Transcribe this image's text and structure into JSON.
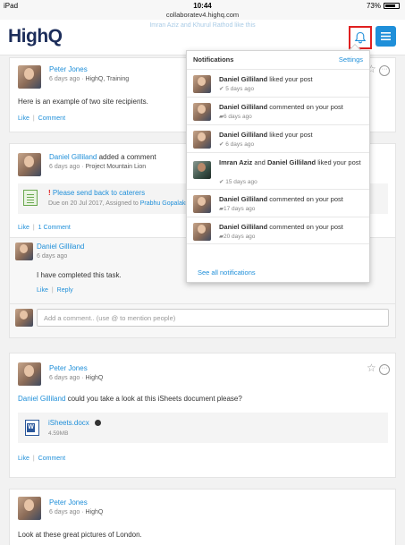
{
  "status": {
    "device": "iPad",
    "time": "10:44",
    "url": "collaboratev4.highq.com",
    "battery": "73%"
  },
  "header": {
    "logo": "HighQ",
    "ghost_text": "Imran Aziz and Khurul Rathod like this"
  },
  "posts": [
    {
      "author": "Peter Jones",
      "meta": "6 days ago",
      "context": "HighQ, Training",
      "body": "Here is an example of two site recipients.",
      "like": "Like",
      "comment": "Comment"
    },
    {
      "author": "Daniel Gilliland",
      "action": "added a comment",
      "meta": "6 days ago",
      "context": "Project Mountain Lion",
      "task": {
        "title": "Please send back to caterers",
        "due_prefix": "Due on 20 Jul 2017, Assigned to",
        "assignee": "Prabhu Gopalakri"
      },
      "like": "Like",
      "comments_count": "1 Comment",
      "reply": {
        "author": "Daniel Gilliland",
        "meta": "6 days ago",
        "body": "I have completed this task.",
        "like": "Like",
        "reply": "Reply"
      },
      "comment_placeholder": "Add a comment.. (use @ to mention people)"
    },
    {
      "author": "Peter Jones",
      "meta": "6 days ago",
      "context": "HighQ",
      "mention": "Daniel Gilliland",
      "body": "could you take a look at this iSheets document please?",
      "file": {
        "name": "iSheets.docx",
        "size": "4.59MB"
      },
      "like": "Like",
      "comment": "Comment"
    },
    {
      "author": "Peter Jones",
      "meta": "6 days ago",
      "context": "HighQ",
      "body": "Look at these great pictures of London."
    }
  ],
  "notifications": {
    "title": "Notifications",
    "settings": "Settings",
    "items": [
      {
        "actor": "Daniel Gilliland",
        "text": "liked your post",
        "time": "5 days ago"
      },
      {
        "actor": "Daniel Gilliland",
        "text": "commented on your post",
        "time": "6 days ago"
      },
      {
        "actor": "Daniel Gilliland",
        "text": "liked your post",
        "time": "6 days ago"
      },
      {
        "actor": "Imran Aziz",
        "and": "and",
        "actor2": "Daniel Gilliland",
        "text": "liked your post",
        "time": "15 days ago"
      },
      {
        "actor": "Daniel Gilliland",
        "text": "commented on your post",
        "time": "17 days ago"
      },
      {
        "actor": "Daniel Gilliland",
        "text": "commented on your post",
        "time": "20 days ago"
      }
    ],
    "see_all": "See all notifications"
  },
  "colors": {
    "brand": "#1c2d5a",
    "accent": "#1f8fd9",
    "highlight": "#e02020"
  }
}
